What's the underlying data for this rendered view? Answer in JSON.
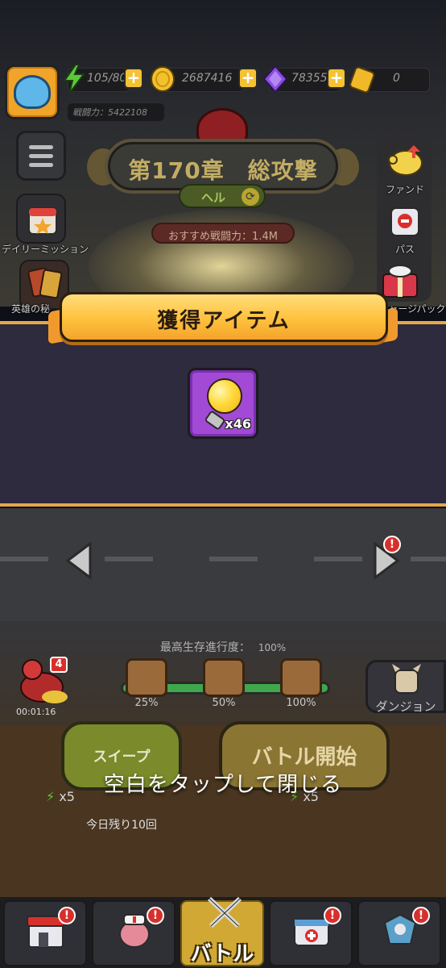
{
  "resources": {
    "stamina": "105/80",
    "gold": "2687416",
    "gems": "78355",
    "tickets": "0"
  },
  "player": {
    "power_label": "戦闘力：5422108"
  },
  "stage": {
    "title": "第170章　総攻撃",
    "difficulty": "ヘル",
    "recommended": "おすすめ戦闘力：1.4M"
  },
  "left_menu": {
    "daily_mission": "デイリーミッション",
    "hero_secret": "英雄の秘"
  },
  "right_menu": {
    "fund": "ファンド",
    "pass": "パス",
    "charge_pack": "チャージパック"
  },
  "popup": {
    "title": "獲得アイテム",
    "item": {
      "icon": "lightbulb-icon",
      "count": "x46"
    },
    "close_hint": "空白をタップして閉じる"
  },
  "progress": {
    "label": "最高生存進行度：",
    "value": "100%",
    "fill_fraction": 1.0,
    "milestones": [
      "25%",
      "50%",
      "100%"
    ]
  },
  "dungeon": {
    "label": "ダンジョン"
  },
  "helper": {
    "badge": "4",
    "timer": "00:01:16"
  },
  "actions": {
    "sweep_label": "スイープ",
    "sweep_cost": "x5",
    "sweep_remaining": "今日残り10回",
    "battle_label": "バトル開始",
    "battle_cost": "x5"
  },
  "notifications": {
    "badge": "!"
  },
  "nav": {
    "battle_label": "バトル"
  },
  "colors": {
    "accent_orange": "#f3a42b",
    "popup_bg": "#2d2b3d",
    "item_purple": "#a24ad6"
  }
}
